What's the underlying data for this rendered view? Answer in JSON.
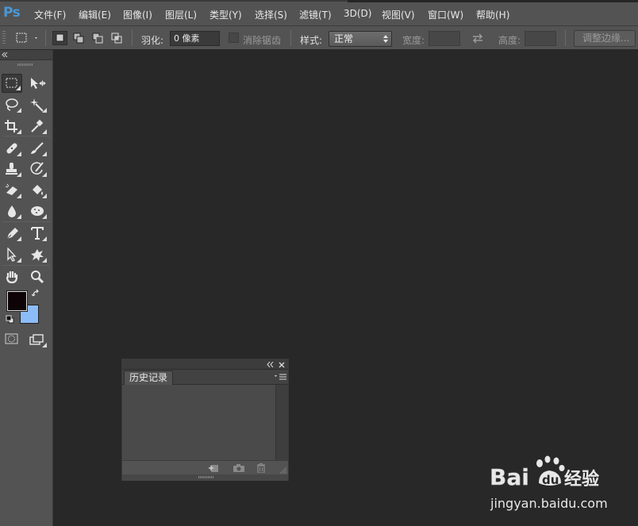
{
  "app": {
    "logo": "Ps"
  },
  "menu": [
    {
      "id": "file",
      "label": "文件(F)"
    },
    {
      "id": "edit",
      "label": "编辑(E)"
    },
    {
      "id": "image",
      "label": "图像(I)"
    },
    {
      "id": "layer",
      "label": "图层(L)"
    },
    {
      "id": "type",
      "label": "类型(Y)"
    },
    {
      "id": "select",
      "label": "选择(S)"
    },
    {
      "id": "filter",
      "label": "滤镜(T)"
    },
    {
      "id": "3d",
      "label": "3D(D)"
    },
    {
      "id": "view",
      "label": "视图(V)"
    },
    {
      "id": "window",
      "label": "窗口(W)"
    },
    {
      "id": "help",
      "label": "帮助(H)"
    }
  ],
  "options": {
    "feather_label": "羽化:",
    "feather_value": "0 像素",
    "antialias_label": "消除锯齿",
    "style_label": "样式:",
    "style_value": "正常",
    "width_label": "宽度:",
    "height_label": "高度:",
    "refine_edge_label": "调整边缘..."
  },
  "colors": {
    "foreground": "#0e0306",
    "background": "#8cbcf8",
    "accent": "#4a97d8"
  },
  "tools": [
    "rectangular-marquee",
    "move",
    "lasso",
    "magic-wand",
    "crop",
    "eyedropper",
    "spot-healing",
    "brush",
    "clone-stamp",
    "history-brush",
    "eraser",
    "paint-bucket",
    "blur",
    "dodge",
    "pen",
    "horizontal-type",
    "path-selection",
    "custom-shape",
    "hand",
    "zoom"
  ],
  "history_panel": {
    "tab_label": "历史记录"
  },
  "watermark": {
    "brand": "Bai du 经验",
    "url": "jingyan.baidu.com"
  }
}
